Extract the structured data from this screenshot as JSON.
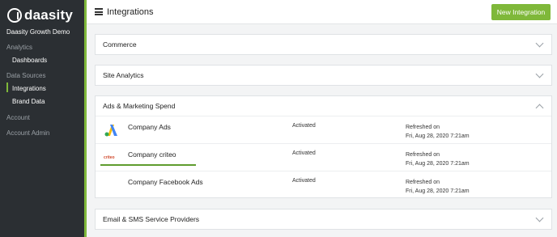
{
  "app": {
    "brand": "daasity",
    "org_name": "Daasity Growth Demo"
  },
  "sidebar": {
    "groups": [
      {
        "label": "Analytics",
        "items": [
          {
            "label": "Dashboards"
          }
        ]
      },
      {
        "label": "Data Sources",
        "items": [
          {
            "label": "Integrations",
            "active": true
          },
          {
            "label": "Brand Data"
          }
        ]
      },
      {
        "label": "Account",
        "items": []
      },
      {
        "label": "Account Admin",
        "items": []
      }
    ]
  },
  "header": {
    "title": "Integrations",
    "new_button": "New Integration"
  },
  "panels": [
    {
      "title": "Commerce",
      "expanded": false
    },
    {
      "title": "Site Analytics",
      "expanded": false
    },
    {
      "title": "Ads & Marketing Spend",
      "expanded": true,
      "rows": [
        {
          "name": "Company Ads",
          "icon": "google-ads-icon",
          "status": "Activated",
          "refresh_label": "Refreshed on",
          "refresh_date": "Fri, Aug 28, 2020 7:21am"
        },
        {
          "name": "Company criteo",
          "icon": "criteo-logo",
          "logo_text": "criteo",
          "status": "Activated",
          "refresh_label": "Refreshed on",
          "refresh_date": "Fri, Aug 28, 2020 7:21am"
        },
        {
          "name": "Company Facebook Ads",
          "icon": "",
          "status": "Activated",
          "refresh_label": "Refreshed on",
          "refresh_date": "Fri, Aug 28, 2020 7:21am"
        }
      ]
    },
    {
      "title": "Email & SMS Service Providers",
      "expanded": false
    }
  ],
  "colors": {
    "accent": "#7fb83a",
    "sidebar_bg": "#2b2f33"
  }
}
